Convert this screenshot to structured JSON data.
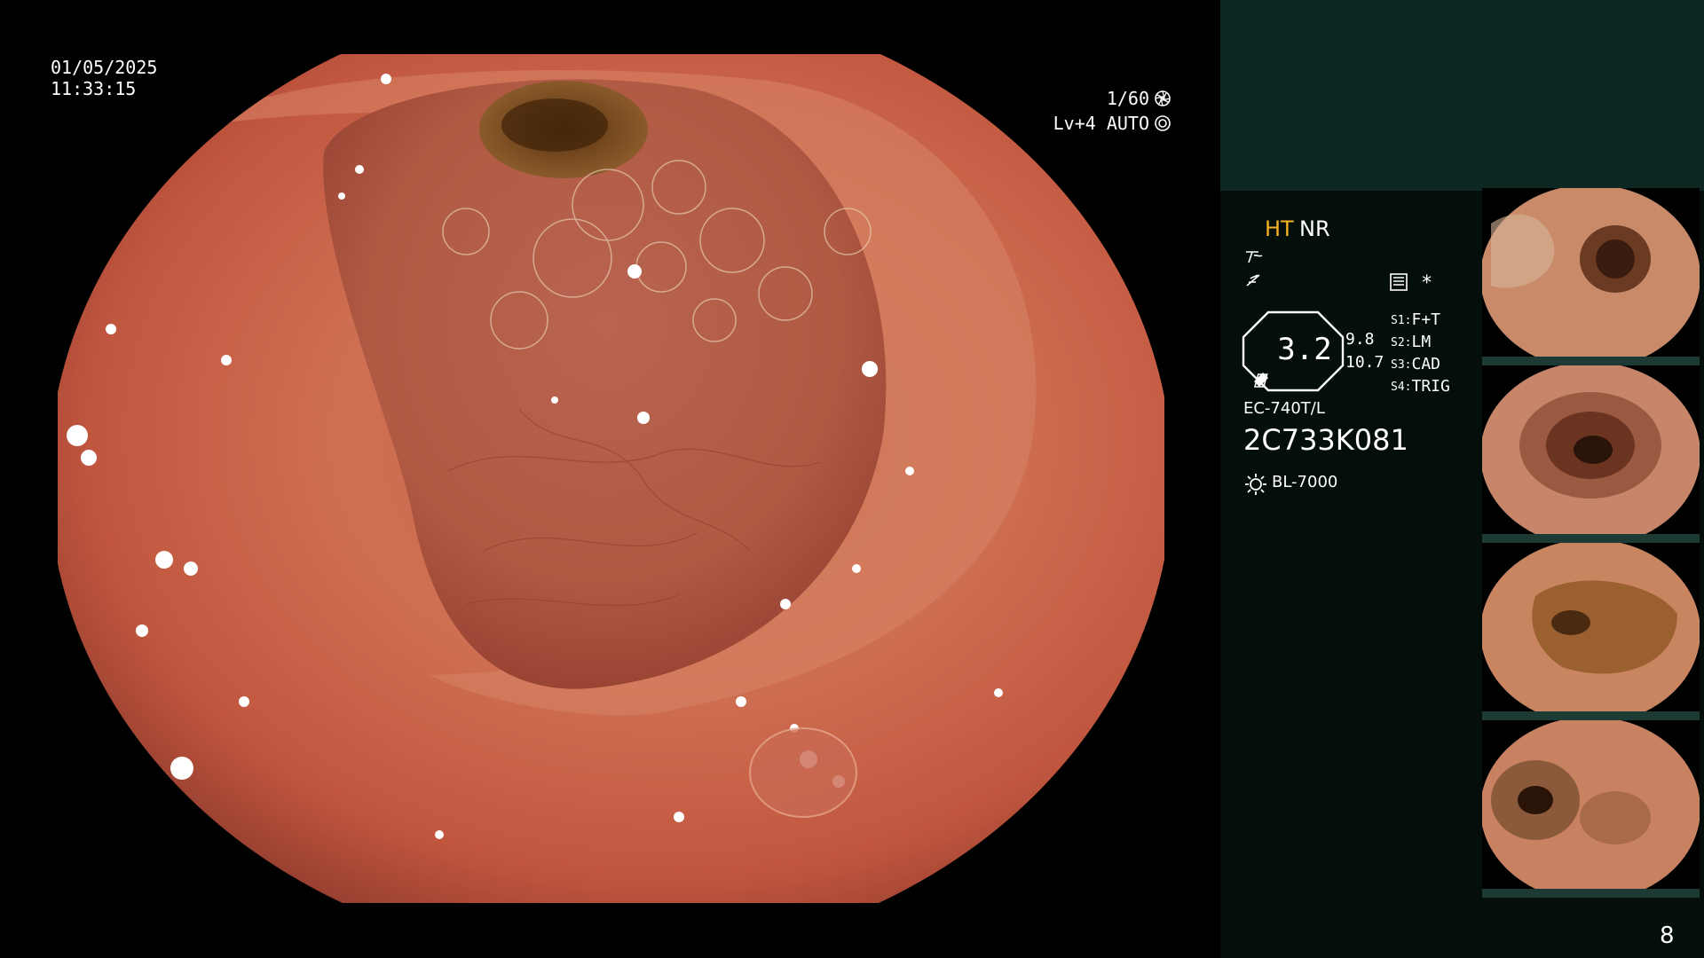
{
  "overlay": {
    "date": "01/05/2025",
    "time": "11:33:15",
    "shutter": "1/60",
    "shutter_icon": "aperture-icon",
    "level": "Lv+4 AUTO",
    "auto_icon": "auto-iris-icon"
  },
  "panel": {
    "mode_primary": "HT",
    "mode_secondary": "NR",
    "colors": {
      "mode_primary": "#f5b324",
      "panel_top": "#0d2723",
      "panel_bg": "#040f0c"
    },
    "structure_icon": "structure-enhance-icon",
    "freeze_icon": "freeze-icon",
    "record_icon": "record-icon",
    "star": "*",
    "zoom": "3.2",
    "value_a": "9.8",
    "value_b": "10.7",
    "switches": [
      {
        "key": "S1:",
        "value": "F+T"
      },
      {
        "key": "S2:",
        "value": "LM"
      },
      {
        "key": "S3:",
        "value": "CAD"
      },
      {
        "key": "S4:",
        "value": "TRIG"
      }
    ],
    "scope_model": "EC-740T/L",
    "scope_serial": "2C733K081",
    "light_icon": "light-source-icon",
    "light_source": "BL-7000",
    "page_number": "8"
  },
  "thumbnails": [
    {
      "name": "capture-1"
    },
    {
      "name": "capture-2"
    },
    {
      "name": "capture-3"
    },
    {
      "name": "capture-4"
    }
  ]
}
